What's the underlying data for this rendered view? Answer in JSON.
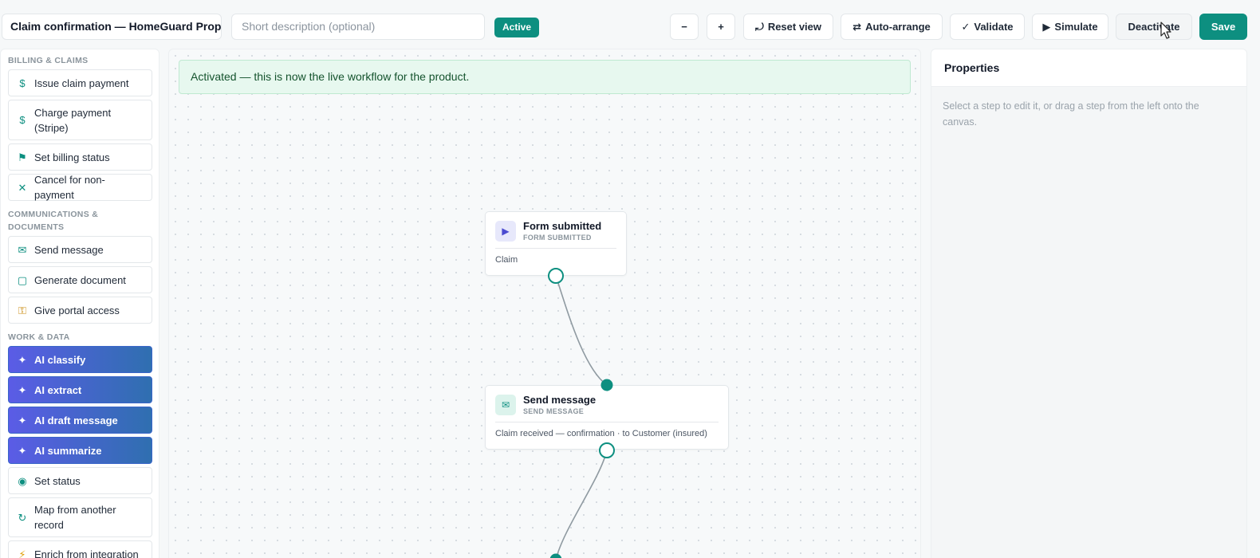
{
  "toolbar": {
    "workflow_title": "Claim confirmation — HomeGuard Prop",
    "description_placeholder": "Short description (optional)",
    "status": "Active",
    "zoom_out_label": "−",
    "zoom_in_label": "+",
    "reset_view_label": "Reset view",
    "auto_arrange_label": "Auto-arrange",
    "validate_label": "Validate",
    "simulate_label": "Simulate",
    "deactivate_label": "Deactivate",
    "save_label": "Save"
  },
  "sidebar": {
    "sections": [
      {
        "title": "BILLING & CLAIMS",
        "items": [
          {
            "label": "Issue claim payment",
            "icon": "dollar-icon"
          },
          {
            "label": "Charge payment (Stripe)",
            "icon": "dollar-icon"
          },
          {
            "label": "Set billing status",
            "icon": "flag-icon"
          },
          {
            "label": "Cancel for non-payment",
            "icon": "x-icon"
          }
        ]
      },
      {
        "title": "COMMUNICATIONS & DOCUMENTS",
        "items": [
          {
            "label": "Send message",
            "icon": "envelope-icon"
          },
          {
            "label": "Generate document",
            "icon": "document-icon"
          },
          {
            "label": "Give portal access",
            "icon": "key-icon"
          }
        ]
      },
      {
        "title": "WORK & DATA",
        "items": [
          {
            "label": "AI classify",
            "icon": "sparkle-icon"
          },
          {
            "label": "AI extract",
            "icon": "sparkle-icon"
          },
          {
            "label": "AI draft message",
            "icon": "sparkle-icon"
          },
          {
            "label": "AI summarize",
            "icon": "sparkle-icon"
          },
          {
            "label": "Set status",
            "icon": "status-dot-icon"
          },
          {
            "label": "Map from another record",
            "icon": "refresh-icon"
          },
          {
            "label": "Enrich from integration",
            "icon": "lightning-icon"
          }
        ]
      }
    ]
  },
  "canvas": {
    "banner": "Activated — this is now the live workflow for the product.",
    "nodes": [
      {
        "title": "Form submitted",
        "type": "FORM SUBMITTED",
        "body": "Claim",
        "icon": "play-icon"
      },
      {
        "title": "Send message",
        "type": "SEND MESSAGE",
        "body": "Claim received — confirmation · to Customer (insured)",
        "icon": "envelope-icon"
      }
    ]
  },
  "properties": {
    "title": "Properties",
    "hint": "Select a step to edit it, or drag a step from the left onto the canvas."
  },
  "colors": {
    "accent": "#0d8f80",
    "ai_gradient_start": "#5b5ce6",
    "ai_gradient_end": "#2f6fb0",
    "banner_bg": "#e7f8ef"
  }
}
